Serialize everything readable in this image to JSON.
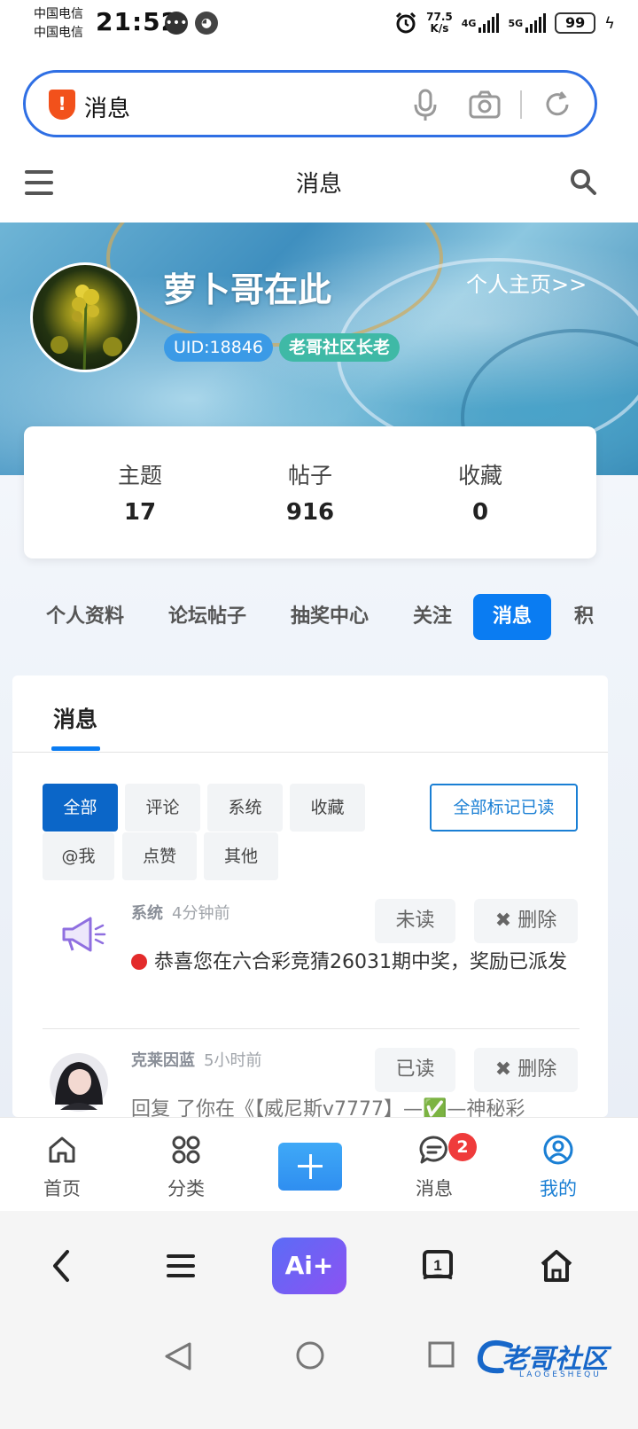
{
  "status_bar": {
    "carrier1": "中国电信",
    "carrier2": "中国电信",
    "time": "21:52",
    "net_speed_value": "77.5",
    "net_speed_unit": "K/s",
    "net1": "4G",
    "net2": "5G",
    "battery": "99"
  },
  "browser": {
    "search_text": "消息"
  },
  "header": {
    "title": "消息"
  },
  "profile": {
    "username": "萝卜哥在此",
    "profile_link": "个人主页>>",
    "uid": "UID:18846",
    "rank": "老哥社区长老"
  },
  "stats": [
    {
      "label": "主题",
      "value": "17"
    },
    {
      "label": "帖子",
      "value": "916"
    },
    {
      "label": "收藏",
      "value": "0"
    }
  ],
  "tabs": [
    "个人资料",
    "论坛帖子",
    "抽奖中心",
    "关注",
    "消息",
    "积"
  ],
  "messages_panel": {
    "title": "消息",
    "filters": [
      "全部",
      "评论",
      "系统",
      "收藏",
      "@我",
      "点赞",
      "其他"
    ],
    "mark_all": "全部标记已读",
    "items": [
      {
        "sender": "系统",
        "time": "4分钟前",
        "status_button": "未读",
        "delete_button": "✖ 删除",
        "body": "恭喜您在六合彩竞猜26031期中奖，奖励已派发"
      },
      {
        "sender": "克莱因蓝",
        "time": "5小时前",
        "status_button": "已读",
        "delete_button": "✖ 删除",
        "body": "回复 了你在《【威尼斯v7777】—✅—神秘彩"
      }
    ]
  },
  "app_nav": {
    "items": [
      "首页",
      "分类",
      "消息",
      "我的"
    ],
    "message_badge": "2"
  },
  "browser_toolbar": {
    "ai_label": "Ai+",
    "tabs_count": "1"
  },
  "watermark": {
    "text": "老哥社区",
    "sub": "LAOGESHEQU"
  },
  "colors": {
    "accent": "#0a7cf2",
    "search_border": "#2f6fe4",
    "badge_red": "#ef3b3b"
  }
}
